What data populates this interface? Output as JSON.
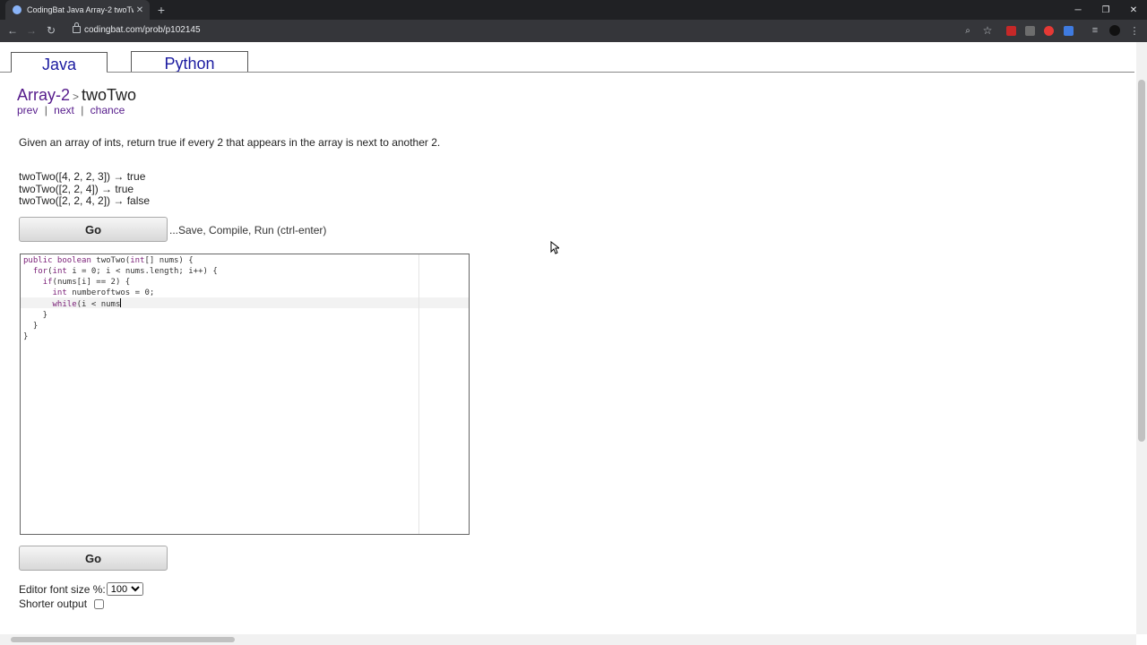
{
  "browser": {
    "tab_title": "CodingBat Java Array-2 twoTwo",
    "url": "codingbat.com/prob/p102145"
  },
  "lang_tabs": [
    "Java",
    "Python"
  ],
  "breadcrumb": {
    "section": "Array-2",
    "sep": ">",
    "problem": "twoTwo"
  },
  "nav": {
    "prev": "prev",
    "next": "next",
    "chance": "chance",
    "divider": "|"
  },
  "description": "Given an array of ints, return true if every 2 that appears in the array is next to another 2.",
  "examples": [
    "twoTwo([4, 2, 2, 3]) → true",
    "twoTwo([2, 2, 4]) → true",
    "twoTwo([2, 2, 4, 2]) → false"
  ],
  "go_label": "Go",
  "go_hint": "...Save, Compile, Run (ctrl-enter)",
  "code_lines": [
    "public boolean twoTwo(int[] nums) {",
    "  for(int i = 0; i < nums.length; i++) {",
    "    if(nums[i] == 2) {",
    "      int numberoftwos = 0;",
    "      while(i < nums",
    "    }",
    "  }",
    "}"
  ],
  "font_size_label": "Editor font size %:",
  "font_size_value": "100",
  "shorter_output_label": "Shorter output",
  "shorter_output_checked": false
}
